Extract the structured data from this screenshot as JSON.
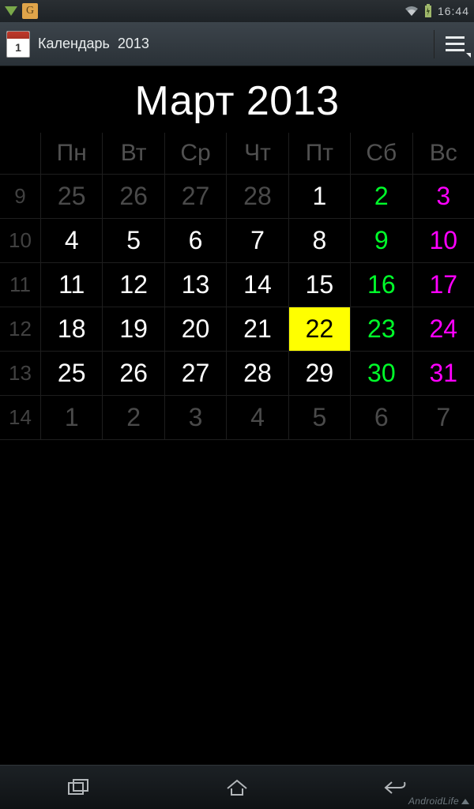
{
  "status": {
    "time": "16:44"
  },
  "appbar": {
    "icon_day": "1",
    "title": "Календарь",
    "year": "2013"
  },
  "month_title": "Март 2013",
  "headers": [
    "Пн",
    "Вт",
    "Ср",
    "Чт",
    "Пт",
    "Сб",
    "Вс"
  ],
  "rows": [
    {
      "wn": "9",
      "cells": [
        {
          "v": "25",
          "t": "out"
        },
        {
          "v": "26",
          "t": "out"
        },
        {
          "v": "27",
          "t": "out"
        },
        {
          "v": "28",
          "t": "out"
        },
        {
          "v": "1",
          "t": "wk"
        },
        {
          "v": "2",
          "t": "sat"
        },
        {
          "v": "3",
          "t": "sun"
        }
      ]
    },
    {
      "wn": "10",
      "cells": [
        {
          "v": "4",
          "t": "wk"
        },
        {
          "v": "5",
          "t": "wk"
        },
        {
          "v": "6",
          "t": "wk"
        },
        {
          "v": "7",
          "t": "wk"
        },
        {
          "v": "8",
          "t": "wk"
        },
        {
          "v": "9",
          "t": "sat"
        },
        {
          "v": "10",
          "t": "sun"
        }
      ]
    },
    {
      "wn": "11",
      "cells": [
        {
          "v": "11",
          "t": "wk"
        },
        {
          "v": "12",
          "t": "wk"
        },
        {
          "v": "13",
          "t": "wk"
        },
        {
          "v": "14",
          "t": "wk"
        },
        {
          "v": "15",
          "t": "wk"
        },
        {
          "v": "16",
          "t": "sat"
        },
        {
          "v": "17",
          "t": "sun"
        }
      ]
    },
    {
      "wn": "12",
      "cells": [
        {
          "v": "18",
          "t": "wk"
        },
        {
          "v": "19",
          "t": "wk"
        },
        {
          "v": "20",
          "t": "wk"
        },
        {
          "v": "21",
          "t": "wk"
        },
        {
          "v": "22",
          "t": "wk",
          "today": true
        },
        {
          "v": "23",
          "t": "sat"
        },
        {
          "v": "24",
          "t": "sun"
        }
      ]
    },
    {
      "wn": "13",
      "cells": [
        {
          "v": "25",
          "t": "wk"
        },
        {
          "v": "26",
          "t": "wk"
        },
        {
          "v": "27",
          "t": "wk"
        },
        {
          "v": "28",
          "t": "wk"
        },
        {
          "v": "29",
          "t": "wk"
        },
        {
          "v": "30",
          "t": "sat"
        },
        {
          "v": "31",
          "t": "sun"
        }
      ]
    },
    {
      "wn": "14",
      "cells": [
        {
          "v": "1",
          "t": "out"
        },
        {
          "v": "2",
          "t": "out"
        },
        {
          "v": "3",
          "t": "out"
        },
        {
          "v": "4",
          "t": "out"
        },
        {
          "v": "5",
          "t": "out"
        },
        {
          "v": "6",
          "t": "out"
        },
        {
          "v": "7",
          "t": "out"
        }
      ]
    }
  ],
  "watermark": "AndroidLife"
}
